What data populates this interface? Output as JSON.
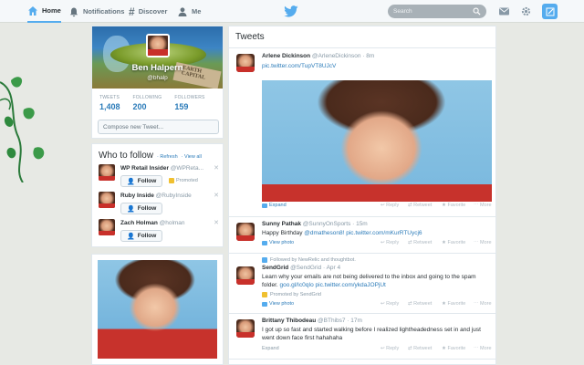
{
  "nav": {
    "home": "Home",
    "notifications": "Notifications",
    "discover": "Discover",
    "me": "Me"
  },
  "search": {
    "placeholder": "Search"
  },
  "colors": {
    "accent": "#55acee",
    "link": "#2b7bb9",
    "background": "#e7e9e4"
  },
  "profile": {
    "name": "Ben Halpern",
    "handle": "@bhalp",
    "banner_sign": "EARTH CAPITAL",
    "stats": [
      {
        "label": "TWEETS",
        "value": "1,408"
      },
      {
        "label": "FOLLOWING",
        "value": "200"
      },
      {
        "label": "FOLLOWERS",
        "value": "159"
      }
    ],
    "compose_placeholder": "Compose new Tweet..."
  },
  "who_to_follow": {
    "title": "Who to follow",
    "refresh": "· Refresh",
    "view_all": "· View all",
    "follow_label": "Follow",
    "promoted_label": "Promoted",
    "suggestions": [
      {
        "name": "WP Retail Insider",
        "handle": "@WPReta..."
      },
      {
        "name": "Ruby Inside",
        "handle": "@RubyInside"
      },
      {
        "name": "Zach Holman",
        "handle": "@holman"
      }
    ]
  },
  "timeline": {
    "title": "Tweets",
    "actions": {
      "reply": "Reply",
      "retweet": "Retweet",
      "favorite": "Favorite",
      "more": "More"
    },
    "tweets": [
      {
        "name": "Arlene Dickinson",
        "handle": "@ArleneDickinson",
        "time": "· 8m",
        "text": "",
        "link": "pic.twitter.com/TupVT8UJcV",
        "footer": "Expand"
      },
      {
        "name": "Sunny Pathak",
        "handle": "@SunnyOnSports",
        "time": "· 15m",
        "text": "Happy Birthday ",
        "link": "@dmatheson8! pic.twitter.com/mKurRTUycj6",
        "footer": "View photo"
      },
      {
        "context": "Followed by NewRelic and thoughtbot.",
        "name": "SendGrid",
        "handle": "@SendGrid",
        "time": "· Apr 4",
        "text": "Learn why your emails are not being delivered to the inbox and going to the spam folder.",
        "link": "goo.gl/Ic0qIo pic.twitter.com/ykdaJOPjUt",
        "promoted_by": "Promoted by SendGrid",
        "footer": "View photo"
      },
      {
        "name": "Brittany Thibodeau",
        "handle": "@BThibs7",
        "time": "· 17m",
        "text": "I got up so fast and started walking before I realized lightheadedness set in and just went down face first hahahaha",
        "link": "",
        "footer": "Expand"
      }
    ]
  }
}
